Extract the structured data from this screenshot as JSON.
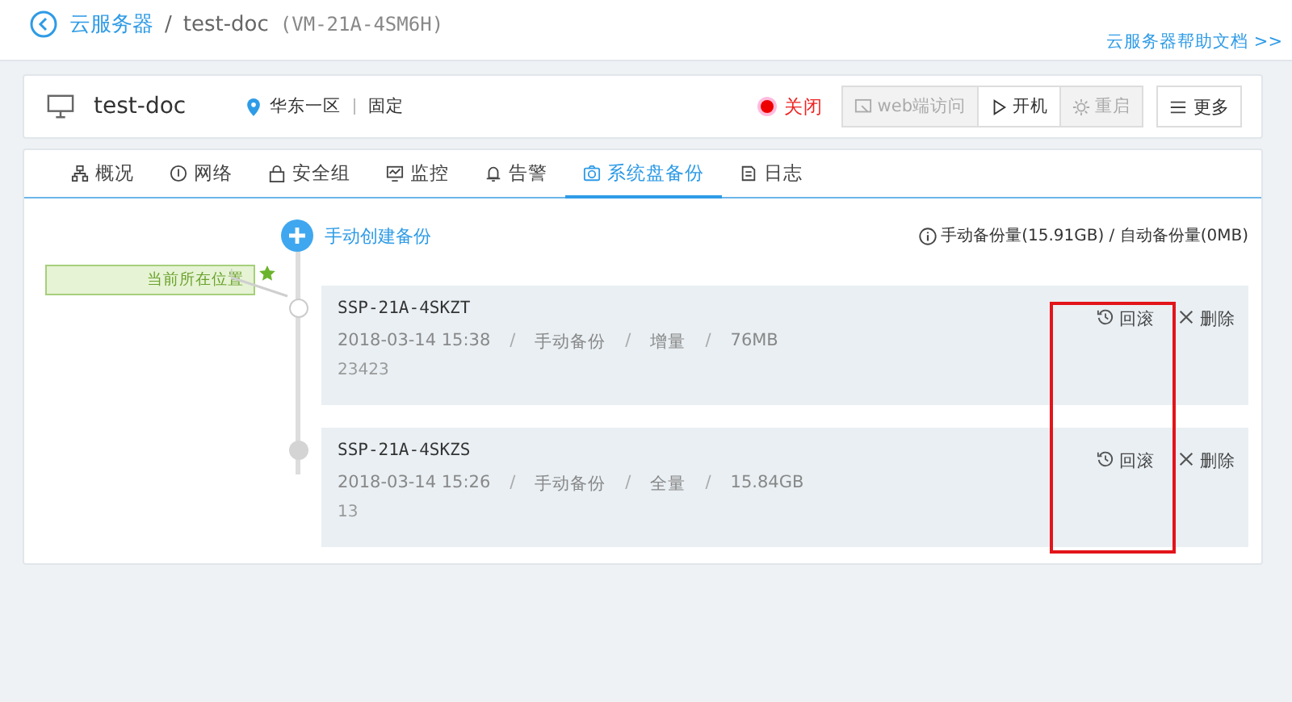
{
  "breadcrumb": {
    "back_label": "云服务器",
    "separator": "/",
    "current": "test-doc",
    "id": "(VM-21A-4SM6H)"
  },
  "help_link": "云服务器帮助文档 >>",
  "server": {
    "name": "test-doc",
    "region": "华东一区",
    "ip_type": "固定",
    "status": "关闭",
    "buttons": [
      {
        "label": "web端访问",
        "kind": "web",
        "disabled": true
      },
      {
        "label": "开机",
        "kind": "start",
        "disabled": false
      },
      {
        "label": "重启",
        "kind": "restart",
        "disabled": true
      }
    ],
    "more": "更多"
  },
  "tabs": [
    {
      "label": "概况",
      "kind": "overview",
      "selected": false
    },
    {
      "label": "网络",
      "kind": "network",
      "selected": false
    },
    {
      "label": "安全组",
      "kind": "security",
      "selected": false
    },
    {
      "label": "监控",
      "kind": "monitor",
      "selected": false
    },
    {
      "label": "告警",
      "kind": "alarm",
      "selected": false
    },
    {
      "label": "系统盘备份",
      "kind": "backup",
      "selected": true
    },
    {
      "label": "日志",
      "kind": "log",
      "selected": false
    }
  ],
  "create_backup": "手动创建备份",
  "usage": "手动备份量(15.91GB) / 自动备份量(0MB)",
  "current_label": "当前所在位置",
  "backups": [
    {
      "name": "SSP-21A-4SKZT",
      "time": "2018-03-14 15:38",
      "mode": "手动备份",
      "type": "增量",
      "size": "76MB",
      "separators": [
        "/",
        "/",
        "/"
      ],
      "note": "23423",
      "current": true,
      "rollback": "回滚",
      "delete": "删除"
    },
    {
      "name": "SSP-21A-4SKZS",
      "time": "2018-03-14 15:26",
      "mode": "手动备份",
      "type": "全量",
      "size": "15.84GB",
      "separators": [
        "/",
        "/",
        "/"
      ],
      "note": "13",
      "current": false,
      "rollback": "回滚",
      "delete": "删除"
    }
  ]
}
